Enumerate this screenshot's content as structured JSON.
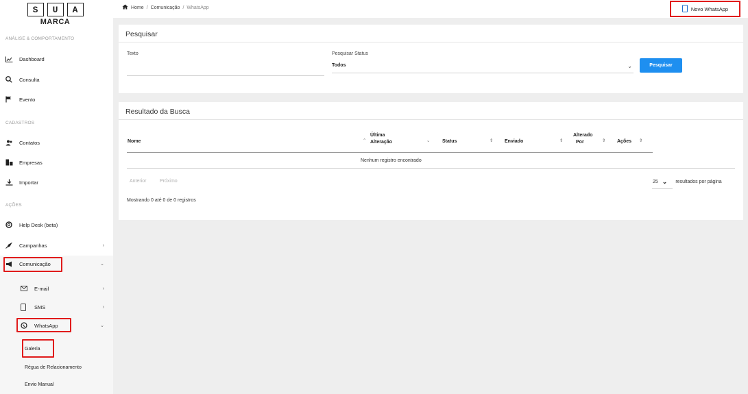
{
  "logo": {
    "letters": [
      "S",
      "U",
      "A"
    ],
    "word": "MARCA"
  },
  "sidebar": {
    "sections": [
      {
        "label": "ANÁLISE & COMPORTAMENTO"
      },
      {
        "label": "CADASTROS"
      },
      {
        "label": "AÇÕES"
      }
    ],
    "items": {
      "dashboard": "Dashboard",
      "consulta": "Consulta",
      "evento": "Evento",
      "contatos": "Contatos",
      "empresas": "Empresas",
      "importar": "Importar",
      "helpdesk": "Help Desk (beta)",
      "campanhas": "Campanhas",
      "comunicacao": "Comunicação",
      "email": "E-mail",
      "sms": "SMS",
      "whatsapp": "WhatsApp",
      "galeria": "Galeria",
      "regua": "Régua de Relacionamento",
      "envio": "Envio Manual"
    }
  },
  "breadcrumb": {
    "home": "Home",
    "sep": "/",
    "level1": "Comunicação",
    "current": "WhatsApp"
  },
  "header": {
    "new_button": "Novo WhatsApp"
  },
  "search": {
    "title": "Pesquisar",
    "text_label": "Texto",
    "text_value": "",
    "status_label": "Pesquisar Status",
    "status_value": "Todos",
    "button": "Pesquisar"
  },
  "results": {
    "title": "Resultado da Busca",
    "columns": {
      "nome": "Nome",
      "ultima1": "Última",
      "ultima2": "Alteração",
      "status": "Status",
      "enviado": "Enviado",
      "alterado1": "Alterado",
      "alterado2": "Por",
      "acoes": "Ações"
    },
    "empty": "Nenhum registro encontrado",
    "prev": "Anterior",
    "next": "Próximo",
    "per_page": "25",
    "per_page_suffix": "resultados por página",
    "info": "Mostrando 0 até 0 de 0 registros"
  },
  "colors": {
    "accent": "#1e8ff0",
    "highlight": "#e01b1b"
  }
}
